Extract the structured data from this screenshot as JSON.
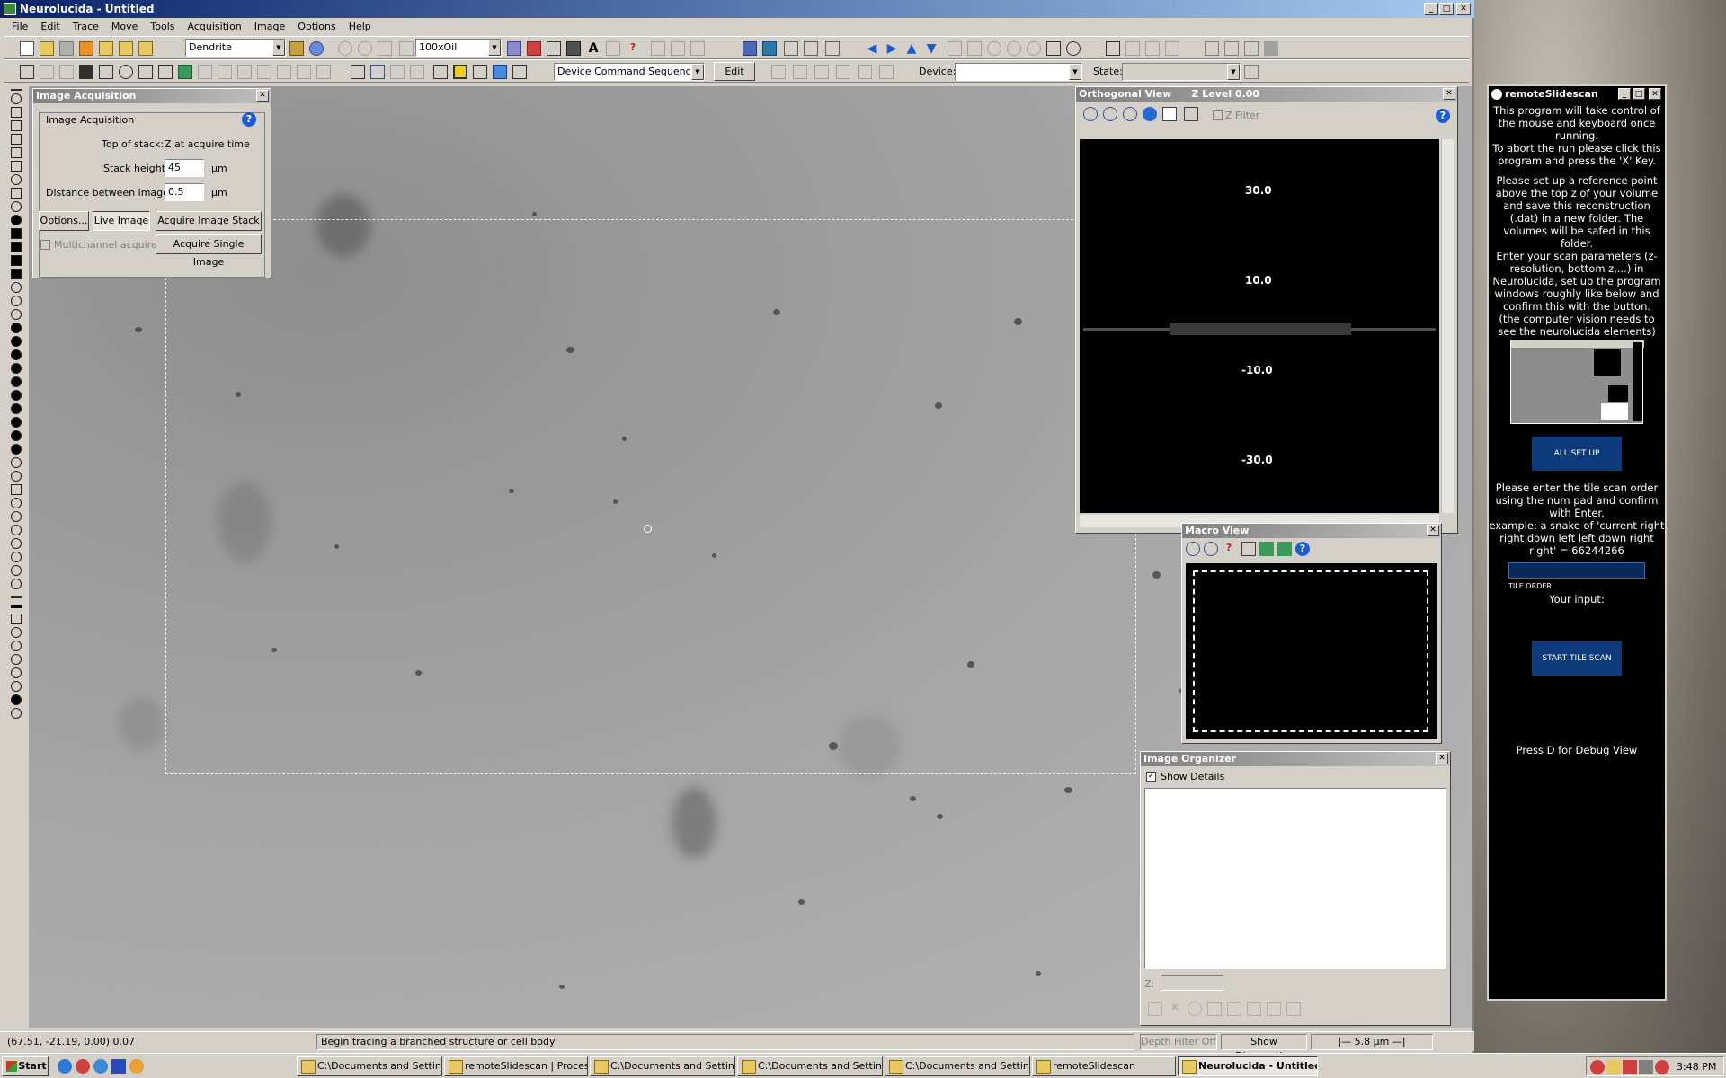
{
  "window": {
    "title": "Neurolucida - Untitled"
  },
  "menu": [
    "File",
    "Edit",
    "Trace",
    "Move",
    "Tools",
    "Acquisition",
    "Image",
    "Options",
    "Help"
  ],
  "toolbar": {
    "tracing_type": "Dendrite",
    "objective": "100xOil",
    "device_sequence": "Device Command Sequence",
    "edit_label": "Edit",
    "device_label": "Device:",
    "device_value": "",
    "state_label": "State:",
    "state_value": ""
  },
  "image_acquisition": {
    "title": "Image Acquisition",
    "group": "Image Acquisition",
    "top_label": "Top of stack:",
    "top_value": "Z at acquire time",
    "height_label": "Stack height:",
    "height_value": "45",
    "height_unit": "µm",
    "dist_label": "Distance between images:",
    "dist_value": "0.5",
    "dist_unit": "µm",
    "options": "Options...",
    "live": "Live Image",
    "stack": "Acquire Image Stack",
    "multichannel": "Multichannel acquire",
    "single": "Acquire Single Image"
  },
  "ortho": {
    "title": "Orthogonal View",
    "zlevel": "Z Level 0.00",
    "zfilter": "Z Filter",
    "ticks": [
      "30.0",
      "10.0",
      "-10.0",
      "-30.0"
    ]
  },
  "macro": {
    "title": "Macro View"
  },
  "organizer": {
    "title": "Image Organizer",
    "show_details": "Show Details",
    "z_label": "Z:"
  },
  "status": {
    "coords": "(67.51, -21.19, 0.00) 0.07",
    "hint": "Begin tracing a branched structure or cell body",
    "depth": "Depth Filter Off",
    "diag": "Show Diagnostics",
    "scale": "5.8 µm"
  },
  "remote": {
    "title": "remoteSlidescan",
    "intro": "This program will take control of the mouse and keyboard once running.\nTo abort the run please click this program and press the 'X' Key.",
    "setup": "Please set up a reference point above the top z of your volume and save this reconstruction (.dat) in a new folder. The volumes will be safed in this folder.\nEnter your scan parameters (z-resolution, bottom z,...) in Neurolucida, set up the program windows roughly like below and confirm this with the button.\n(the computer vision needs to see the neurolucida elements)",
    "all_set": "ALL SET UP",
    "order": "Please enter the tile scan order using the num pad and confirm with Enter.\nexample: a snake of 'current right right down left left down right right' = 66244266",
    "tile_order": "TILE ORDER",
    "your_input": "Your input:",
    "start": "START TILE SCAN",
    "debug": "Press D for Debug View"
  },
  "taskbar": {
    "start": "Start",
    "tasks": [
      "C:\\Documents and Settin...",
      "remoteSlidescan | Proces...",
      "C:\\Documents and Settin...",
      "C:\\Documents and Settin...",
      "C:\\Documents and Settin...",
      "remoteSlidescan",
      "Neurolucida - Untitled"
    ],
    "clock": "3:48 PM"
  }
}
